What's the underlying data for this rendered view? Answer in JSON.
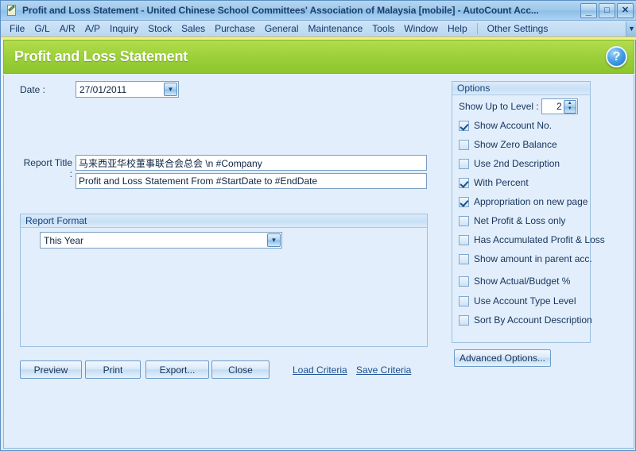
{
  "window": {
    "title": "Profit and Loss Statement - United Chinese School Committees' Association of Malaysia [mobile] - AutoCount Acc...",
    "icon": "document-pencil-icon",
    "controls": {
      "minimize": "_",
      "maximize": "□",
      "close": "✕"
    }
  },
  "menu": {
    "items": [
      "File",
      "G/L",
      "A/R",
      "A/P",
      "Inquiry",
      "Stock",
      "Sales",
      "Purchase",
      "General",
      "Maintenance",
      "Tools",
      "Window",
      "Help"
    ],
    "extra": "Other Settings",
    "overflow_glyph": "▼"
  },
  "header": {
    "title": "Profit and Loss Statement",
    "help_glyph": "?",
    "accent_color": "#9ed13c"
  },
  "form": {
    "date_label": "Date :",
    "date_value": "27/01/2011",
    "report_title_label": "Report Title :",
    "report_title_line1": "马来西亚华校董事联合会总会 \\n #Company",
    "report_title_line2": "Profit and Loss Statement From #StartDate to #EndDate",
    "report_format_caption": "Report Format",
    "report_format_value": "This Year",
    "combo_glyph": "▼"
  },
  "buttons": {
    "preview": "Preview",
    "print": "Print",
    "export": "Export...",
    "close": "Close",
    "advanced_options": "Advanced Options..."
  },
  "links": {
    "load_criteria": "Load Criteria",
    "save_criteria": "Save Criteria"
  },
  "options": {
    "caption": "Options",
    "level_label": "Show Up to Level :",
    "level_value": "2",
    "spin_up": "▲",
    "spin_down": "▼",
    "checkboxes": [
      {
        "label": "Show Account No.",
        "checked": true
      },
      {
        "label": "Show Zero Balance",
        "checked": false
      },
      {
        "label": "Use 2nd Description",
        "checked": false
      },
      {
        "label": "With Percent",
        "checked": true
      },
      {
        "label": "Appropriation on new page",
        "checked": true
      },
      {
        "label": "Net Profit & Loss only",
        "checked": false
      },
      {
        "label": "Has Accumulated Profit & Loss",
        "checked": false
      },
      {
        "label": "Show amount in parent acc.",
        "checked": false
      },
      {
        "label": "Show Actual/Budget %",
        "checked": false
      },
      {
        "label": "Use Account Type Level",
        "checked": false
      },
      {
        "label": "Sort By Account Description",
        "checked": false
      }
    ]
  }
}
